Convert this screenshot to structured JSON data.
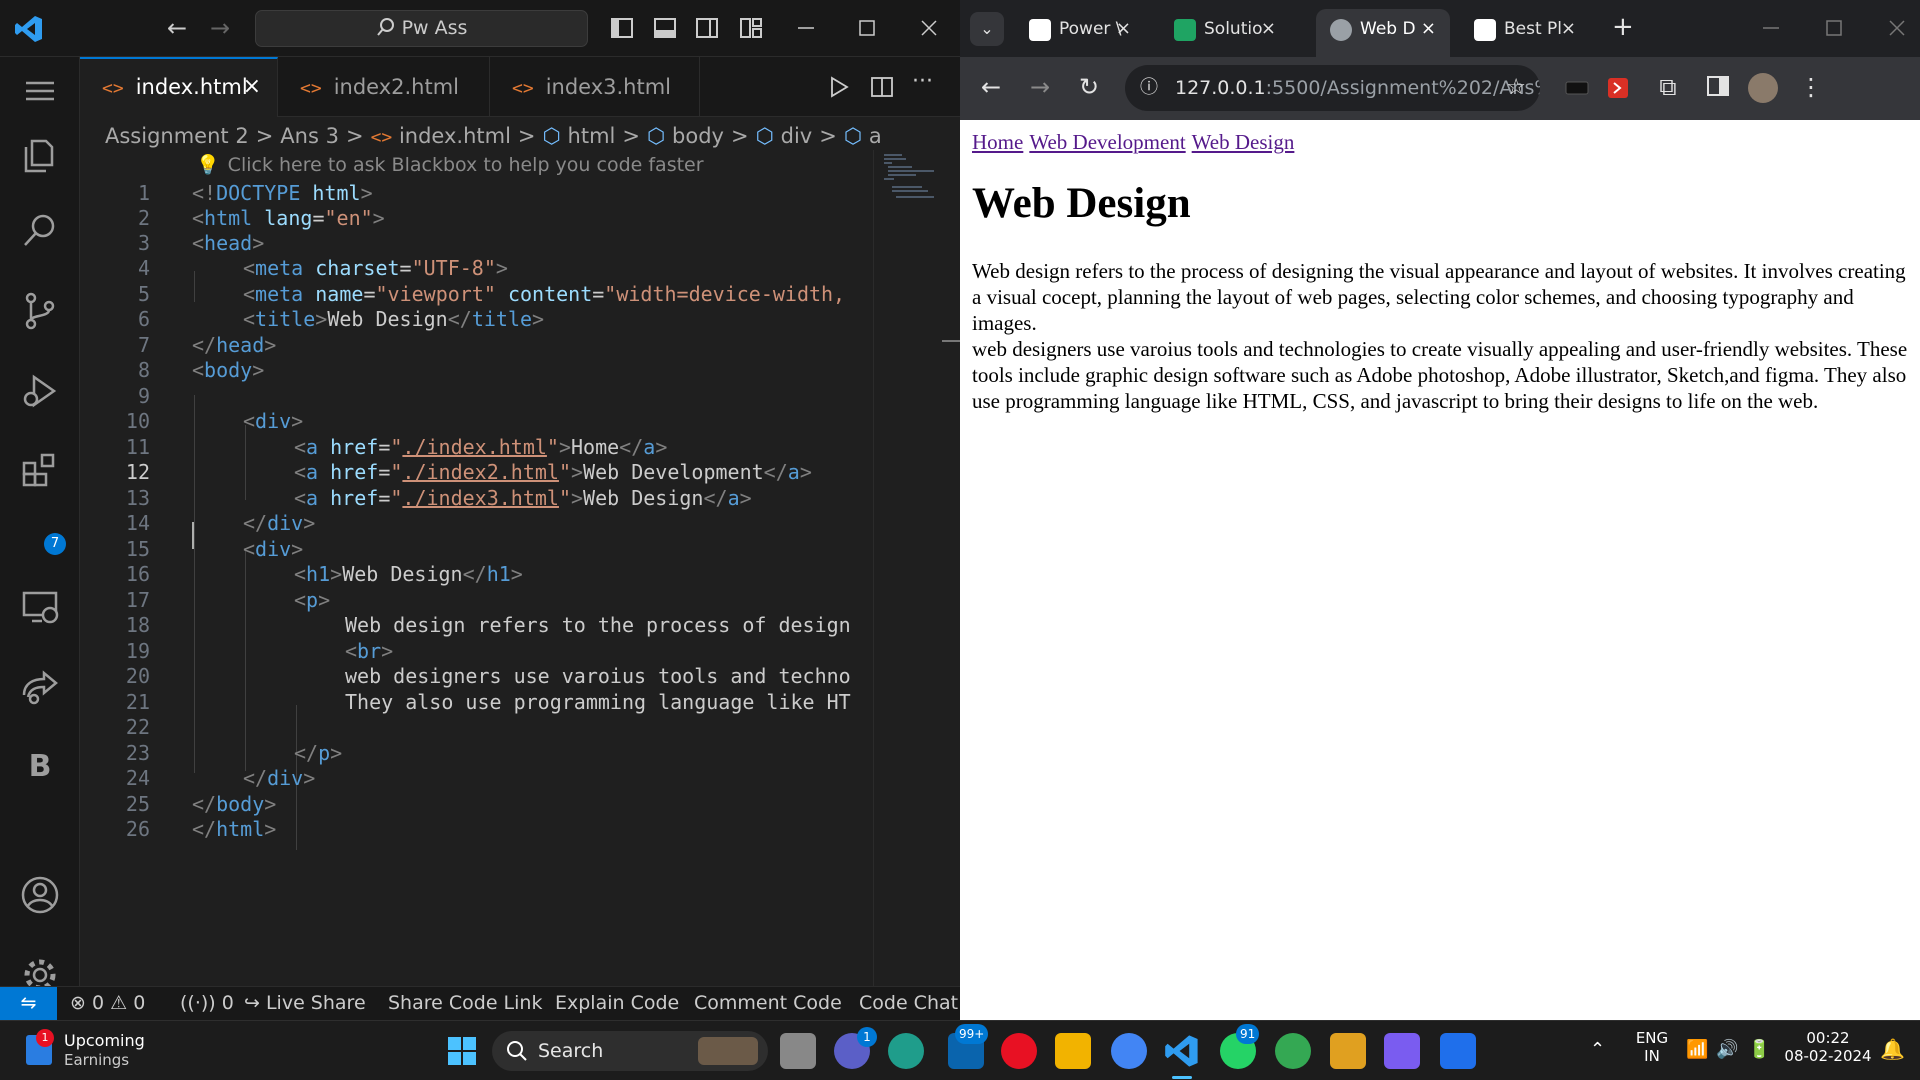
{
  "vscode": {
    "search": "Pw Ass",
    "tabs": [
      {
        "label": "index.html",
        "icon": "<>"
      },
      {
        "label": "index2.html",
        "icon": "<>"
      },
      {
        "label": "index3.html",
        "icon": "<>"
      }
    ],
    "tab_close": "×",
    "breadcrumb": [
      "Assignment 2",
      "Ans 3",
      "index.html",
      "html",
      "body",
      "div",
      "a"
    ],
    "breadcrumb_sep": ">",
    "hint": "Click here to ask Blackbox to help you code faster",
    "activity_badge": "7",
    "line_numbers": [
      "1",
      "2",
      "3",
      "4",
      "5",
      "6",
      "7",
      "8",
      "9",
      "10",
      "11",
      "12",
      "13",
      "14",
      "15",
      "16",
      "17",
      "18",
      "19",
      "20",
      "21",
      "22",
      "23",
      "24",
      "25",
      "26"
    ],
    "current_line": "12",
    "code": {
      "l1_a": "<!",
      "l1_b": "DOCTYPE",
      "l1_c": " html",
      "l1_d": ">",
      "l2_a": "<",
      "l2_b": "html",
      "l2_c": " lang",
      "l2_d": "=",
      "l2_e": "\"en\"",
      "l2_f": ">",
      "l3_a": "<",
      "l3_b": "head",
      "l3_c": ">",
      "l4_a": "<",
      "l4_b": "meta",
      "l4_c": " charset",
      "l4_d": "=",
      "l4_e": "\"UTF-8\"",
      "l4_f": ">",
      "l5_a": "<",
      "l5_b": "meta",
      "l5_c": " name",
      "l5_d": "=",
      "l5_e": "\"viewport\"",
      "l5_f": " content",
      "l5_g": "=",
      "l5_h": "\"width=device-width,",
      "l6_a": "<",
      "l6_b": "title",
      "l6_c": ">",
      "l6_d": "Web Design",
      "l6_e": "</",
      "l6_f": "title",
      "l6_g": ">",
      "l7_a": "</",
      "l7_b": "head",
      "l7_c": ">",
      "l8_a": "<",
      "l8_b": "body",
      "l8_c": ">",
      "l10_a": "<",
      "l10_b": "div",
      "l10_c": ">",
      "l11_a": "<",
      "l11_b": "a",
      "l11_c": " href",
      "l11_d": "=",
      "l11_e": "\"",
      "l11_f": "./index.html",
      "l11_g": "\"",
      "l11_h": ">",
      "l11_i": "Home",
      "l11_j": "</",
      "l11_k": "a",
      "l11_l": ">",
      "l12_a": "<",
      "l12_b": "a",
      "l12_c": " href",
      "l12_d": "=",
      "l12_e": "\"",
      "l12_f": "./index2.html",
      "l12_g": "\"",
      "l12_h": ">",
      "l12_i": "Web Development",
      "l12_j": "</",
      "l12_k": "a",
      "l12_l": ">",
      "l13_a": "<",
      "l13_b": "a",
      "l13_c": " href",
      "l13_d": "=",
      "l13_e": "\"",
      "l13_f": "./index3.html",
      "l13_g": "\"",
      "l13_h": ">",
      "l13_i": "Web Design",
      "l13_j": "</",
      "l13_k": "a",
      "l13_l": ">",
      "l14_a": "</",
      "l14_b": "div",
      "l14_c": ">",
      "l15_a": "<",
      "l15_b": "div",
      "l15_c": ">",
      "l16_a": "<",
      "l16_b": "h1",
      "l16_c": ">",
      "l16_d": "Web Design",
      "l16_e": "</",
      "l16_f": "h1",
      "l16_g": ">",
      "l17_a": "<",
      "l17_b": "p",
      "l17_c": ">",
      "l18": "Web design refers to the process of design",
      "l19_a": "<",
      "l19_b": "br",
      "l19_c": ">",
      "l20": "web designers use varoius tools and techno",
      "l21": "They also use programming language like HT",
      "l23_a": "</",
      "l23_b": "p",
      "l23_c": ">",
      "l24_a": "</",
      "l24_b": "div",
      "l24_c": ">",
      "l25_a": "</",
      "l25_b": "body",
      "l25_c": ">",
      "l26_a": "</",
      "l26_b": "html",
      "l26_c": ">"
    },
    "status": {
      "errors": "0",
      "warnings": "0",
      "ports": "0",
      "live_share": "Live Share",
      "share_code_link": "Share Code Link",
      "explain_code": "Explain Code",
      "comment_code": "Comment Code",
      "code_chat": "Code Chat"
    }
  },
  "browser": {
    "tabs": [
      {
        "label": "Power \\",
        "color": "#ffffff"
      },
      {
        "label": "Solutio",
        "color": "#1fa463"
      },
      {
        "label": "Web D",
        "color": "#9aa0a6"
      },
      {
        "label": "Best Pl",
        "color": "#ffffff"
      }
    ],
    "tab_close": "×",
    "new_tab": "+",
    "url_host": "127.0.0.1",
    "url_path": ":5500/Assignment%202/Ans%...",
    "page": {
      "nav": [
        "Home",
        "Web Development",
        "Web Design"
      ],
      "heading": "Web Design",
      "para1": "Web design refers to the process of designing the visual appearance and layout of websites. It involves creating a visual cocept, planning the layout of web pages, selecting color schemes, and choosing typography and images.",
      "para2": "web designers use varoius tools and technologies to create visually appealing and user-friendly websites. These tools include graphic design software such as Adobe photoshop, Adobe illustrator, Sketch,and figma. They also use programming language like HTML, CSS, and javascript to bring their designs to life on the web."
    }
  },
  "taskbar": {
    "widget_badge": "1",
    "widget_title": "Upcoming",
    "widget_subtitle": "Earnings",
    "search": "Search",
    "teams_badge": "1",
    "mail_badge": "99+",
    "whatsapp_badge": "91",
    "lang": "ENG",
    "region": "IN",
    "time": "00:22",
    "date": "08-02-2024"
  }
}
